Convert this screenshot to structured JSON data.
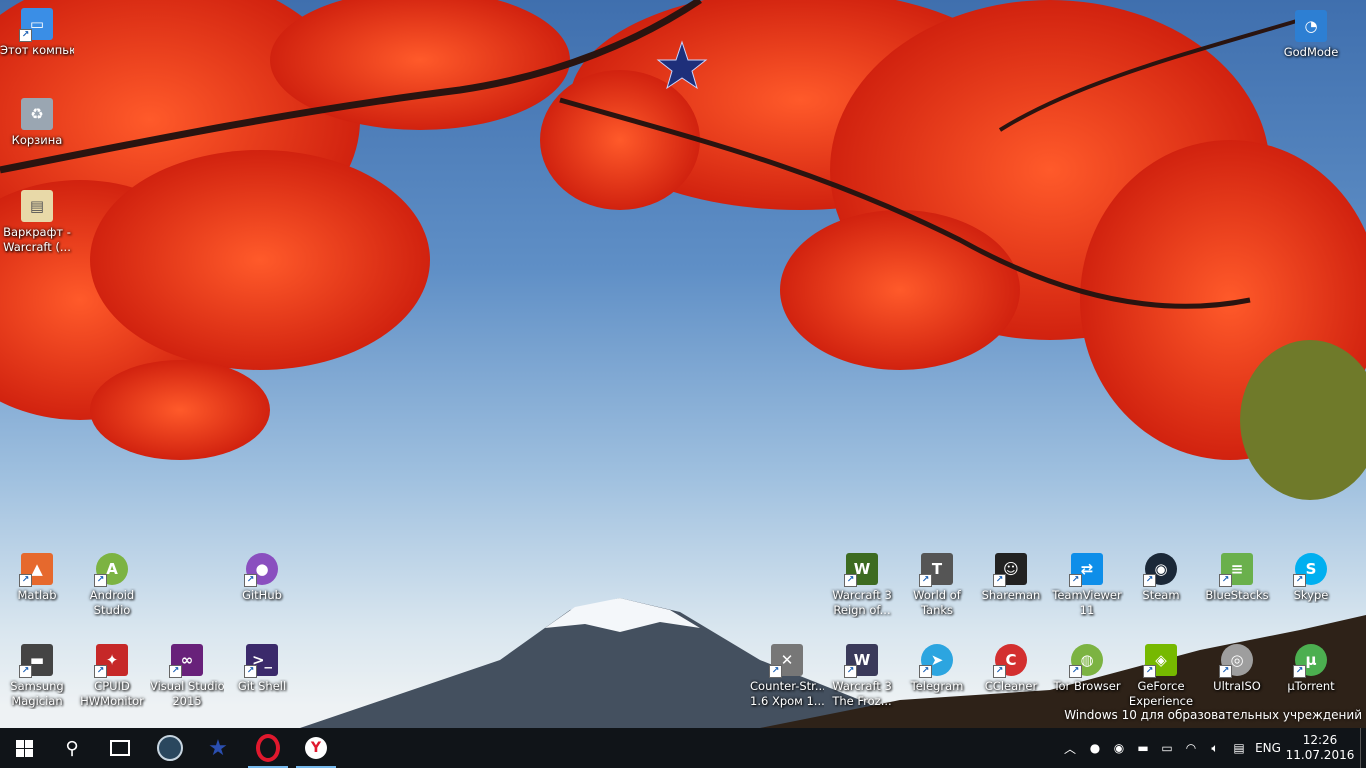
{
  "desktop": {
    "left_icons": [
      {
        "label": "Этот компьютер",
        "line2": "",
        "icon": "computer-icon",
        "color": "#3a8ee6"
      },
      {
        "label": "Корзина",
        "line2": "",
        "icon": "recycle-bin-icon",
        "color": "#9aa6b2"
      },
      {
        "label": "Варкрафт -",
        "line2": "Warcraft (...",
        "icon": "file-icon",
        "color": "#e8d9a8"
      }
    ],
    "top_right_icon": {
      "label": "GodMode",
      "icon": "control-panel-icon",
      "color": "#2d7fd3"
    },
    "row1": [
      {
        "label": "Matlab",
        "line2": "",
        "icon": "matlab-icon",
        "color": "#e6692d"
      },
      {
        "label": "Android",
        "line2": "Studio",
        "icon": "android-studio-icon",
        "color": "#7cb342"
      },
      {
        "label": "GitHub",
        "line2": "",
        "icon": "github-icon",
        "color": "#8a4fbf"
      },
      {
        "label": "Warcraft 3",
        "line2": "Reign of...",
        "icon": "warcraft-icon",
        "color": "#3d6b21"
      },
      {
        "label": "World of",
        "line2": "Tanks",
        "icon": "world-of-tanks-icon",
        "color": "#555555"
      },
      {
        "label": "Shareman",
        "line2": "",
        "icon": "shareman-icon",
        "color": "#222222"
      },
      {
        "label": "TeamViewer",
        "line2": "11",
        "icon": "teamviewer-icon",
        "color": "#0e8ee9"
      },
      {
        "label": "Steam",
        "line2": "",
        "icon": "steam-icon",
        "color": "#1b2838"
      },
      {
        "label": "BlueStacks",
        "line2": "",
        "icon": "bluestacks-icon",
        "color": "#6ab04c"
      },
      {
        "label": "Skype",
        "line2": "",
        "icon": "skype-icon",
        "color": "#00aff0"
      }
    ],
    "row2": [
      {
        "label": "Samsung",
        "line2": "Magician",
        "icon": "samsung-magician-icon",
        "color": "#444444"
      },
      {
        "label": "CPUID",
        "line2": "HWMonitor",
        "icon": "hwmonitor-icon",
        "color": "#c62828"
      },
      {
        "label": "Visual Studio",
        "line2": "2015",
        "icon": "visual-studio-icon",
        "color": "#68217a"
      },
      {
        "label": "Git Shell",
        "line2": "",
        "icon": "git-shell-icon",
        "color": "#3b2a6b"
      },
      {
        "label": "Counter-Str...",
        "line2": "1.6 Хром 1....",
        "icon": "counter-strike-icon",
        "color": "#777777"
      },
      {
        "label": "Warcraft 3",
        "line2": "The Froz...",
        "icon": "warcraft-frozen-throne-icon",
        "color": "#3a3a5a"
      },
      {
        "label": "Telegram",
        "line2": "",
        "icon": "telegram-icon",
        "color": "#2ca5e0"
      },
      {
        "label": "CCleaner",
        "line2": "",
        "icon": "ccleaner-icon",
        "color": "#d32f2f"
      },
      {
        "label": "Tor Browser",
        "line2": "",
        "icon": "tor-browser-icon",
        "color": "#7cb342"
      },
      {
        "label": "GeForce",
        "line2": "Experience",
        "icon": "geforce-icon",
        "color": "#76b900"
      },
      {
        "label": "UltraISO",
        "line2": "",
        "icon": "ultraiso-icon",
        "color": "#9e9e9e"
      },
      {
        "label": "µTorrent",
        "line2": "",
        "icon": "utorrent-icon",
        "color": "#4caf50"
      }
    ],
    "watermark": "Windows 10 для образовательных учреждений"
  },
  "taskbar": {
    "pinned": [
      {
        "icon": "windows-start-icon"
      },
      {
        "icon": "search-icon"
      },
      {
        "icon": "task-view-icon"
      },
      {
        "icon": "steam-icon"
      },
      {
        "icon": "star-app-icon"
      },
      {
        "icon": "opera-icon"
      },
      {
        "icon": "yandex-browser-icon"
      }
    ],
    "language": "ENG",
    "time": "12:26",
    "date": "11.07.2016"
  },
  "colors": {
    "taskbar_bg": "#101418",
    "accent": "#76b9ed"
  }
}
